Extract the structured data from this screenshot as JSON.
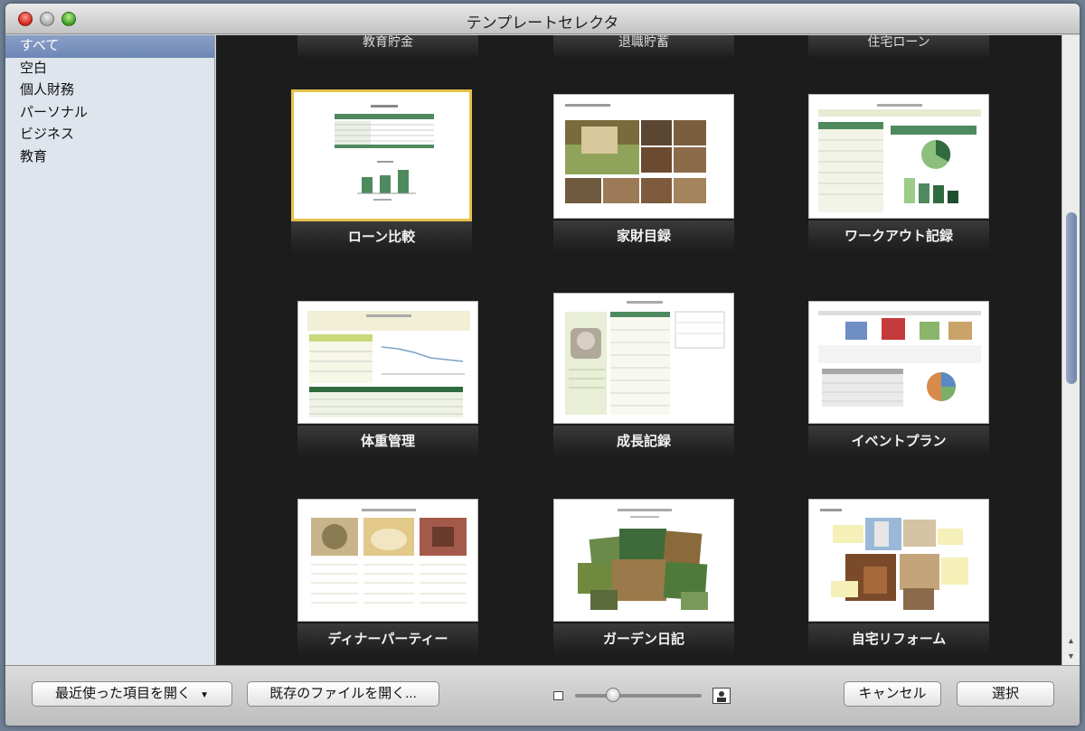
{
  "window": {
    "title": "テンプレートセレクタ"
  },
  "sidebar": {
    "items": [
      {
        "label": "すべて",
        "selected": true
      },
      {
        "label": "空白"
      },
      {
        "label": "個人財務"
      },
      {
        "label": "パーソナル"
      },
      {
        "label": "ビジネス"
      },
      {
        "label": "教育"
      }
    ]
  },
  "grid": {
    "top_row_labels": [
      "教育貯金",
      "退職貯蓄",
      "住宅ローン"
    ],
    "templates": [
      {
        "label": "ローン比較",
        "selected": true,
        "icon": "loan-comparison-thumbnail"
      },
      {
        "label": "家財目録",
        "icon": "home-inventory-thumbnail"
      },
      {
        "label": "ワークアウト記録",
        "icon": "workout-log-thumbnail"
      },
      {
        "label": "体重管理",
        "icon": "weight-management-thumbnail"
      },
      {
        "label": "成長記録",
        "icon": "growth-record-thumbnail"
      },
      {
        "label": "イベントプラン",
        "icon": "event-plan-thumbnail"
      },
      {
        "label": "ディナーパーティー",
        "icon": "dinner-party-thumbnail"
      },
      {
        "label": "ガーデン日記",
        "icon": "garden-diary-thumbnail"
      },
      {
        "label": "自宅リフォーム",
        "icon": "home-remodel-thumbnail"
      }
    ]
  },
  "footer": {
    "recent_label": "最近使った項目を開く",
    "open_existing_label": "既存のファイルを開く...",
    "cancel_label": "キャンセル",
    "choose_label": "選択"
  },
  "colors": {
    "accent_selected": "#e6c14c",
    "sidebar_selection": "#7a90bd",
    "grid_bg": "#1c1c1c",
    "sheet_green": "#3f7d4f"
  }
}
